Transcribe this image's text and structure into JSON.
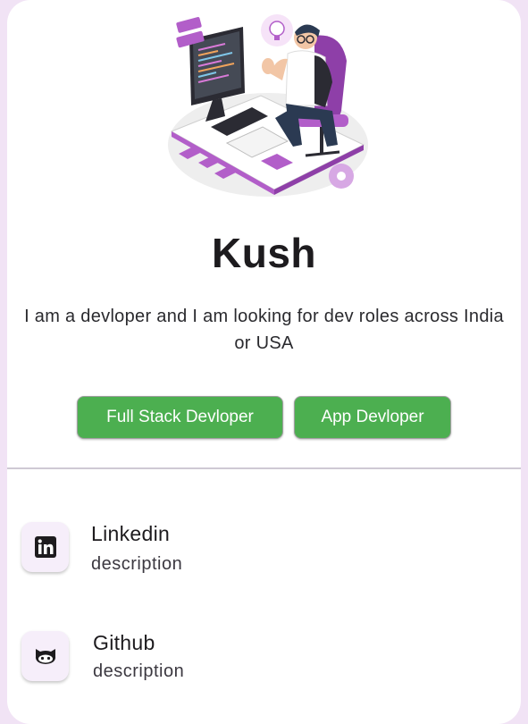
{
  "profile": {
    "name": "Kush",
    "bio_line1": "I am a devloper and I am looking for dev roles across India",
    "bio_line2": "or USA",
    "illustration_icon": "developer-at-desk-illustration"
  },
  "chips": [
    {
      "label": "Full Stack Devloper"
    },
    {
      "label": "App Devloper"
    }
  ],
  "links": [
    {
      "title": "Linkedin",
      "description": "description",
      "icon": "linkedin-icon"
    },
    {
      "title": "Github",
      "description": "description",
      "icon": "github-icon"
    }
  ],
  "colors": {
    "background": "#f1e3f5",
    "card": "#ffffff",
    "chip": "#4caf50",
    "accent": "#a463c4",
    "icon_tile": "#f6eefa"
  }
}
